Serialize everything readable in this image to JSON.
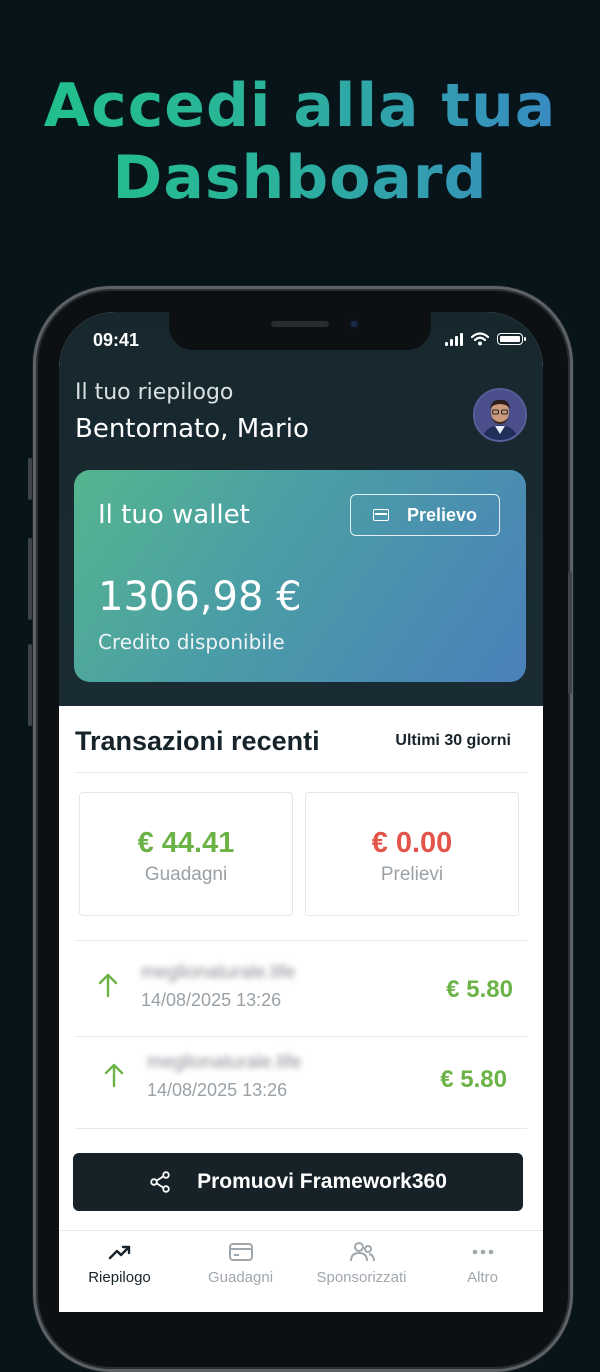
{
  "headline": {
    "line1": "Accedi alla tua",
    "line2": "Dashboard"
  },
  "status_bar": {
    "time": "09:41"
  },
  "greeting": {
    "subtitle": "Il tuo riepilogo",
    "title": "Bentornato, Mario"
  },
  "wallet": {
    "title": "Il tuo wallet",
    "withdraw_label": "Prelievo",
    "balance": "1306,98 €",
    "balance_label": "Credito disponibile"
  },
  "transactions": {
    "title": "Transazioni recenti",
    "range": "Ultimi 30 giorni",
    "stats": [
      {
        "value": "€ 44.41",
        "label": "Guadagni",
        "color": "#6cb347"
      },
      {
        "value": "€ 0.00",
        "label": "Prelievi",
        "color": "#e3554a"
      }
    ],
    "items": [
      {
        "description": "meglionaturale.life",
        "date": "14/08/2025 13:26",
        "amount": "€ 5.80"
      },
      {
        "description": "meglionaturale.life",
        "date": "14/08/2025 13:26",
        "amount": "€ 5.80"
      }
    ]
  },
  "promo": {
    "label": "Promuovi Framework360",
    "icon": "share-icon"
  },
  "tabbar": [
    {
      "label": "Riepilogo",
      "icon": "trend-icon",
      "active": true
    },
    {
      "label": "Guadagni",
      "icon": "card-icon",
      "active": false
    },
    {
      "label": "Sponsorizzati",
      "icon": "users-icon",
      "active": false
    },
    {
      "label": "Altro",
      "icon": "more-icon",
      "active": false
    }
  ],
  "colors": {
    "headline_gradient": [
      "#1fc28a",
      "#3a85c8"
    ],
    "positive": "#6cb347",
    "negative": "#e3554a",
    "dark": "#162228"
  }
}
